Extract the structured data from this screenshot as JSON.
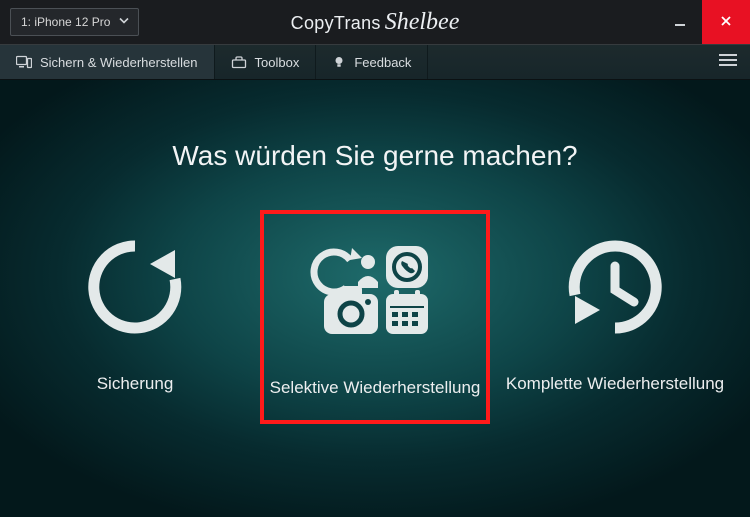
{
  "titlebar": {
    "device_label": "1: iPhone 12 Pro",
    "brand_part1": "CopyTrans",
    "brand_part2": "Shelbee"
  },
  "tabs": {
    "backup_restore": {
      "label": "Sichern & Wiederherstellen"
    },
    "toolbox": {
      "label": "Toolbox"
    },
    "feedback": {
      "label": "Feedback"
    }
  },
  "main": {
    "heading": "Was würden Sie gerne machen?",
    "options": {
      "backup": {
        "label": "Sicherung"
      },
      "selective_restore": {
        "label": "Selektive Wiederherstellung"
      },
      "full_restore": {
        "label": "Komplette Wiederherstellung"
      }
    }
  },
  "icons": {
    "device_chevron": "chevron-down-icon",
    "tab_backup": "devices-icon",
    "tab_toolbox": "toolbox-icon",
    "tab_feedback": "lightbulb-icon",
    "hamburger": "menu-icon",
    "minimize": "minimize-icon",
    "close": "close-icon",
    "opt_backup": "refresh-arrow-icon",
    "opt_selective": "selective-restore-icon",
    "opt_full": "history-restore-icon"
  },
  "colors": {
    "accent_highlight": "#ff1a1a",
    "close_button": "#e81123",
    "icon_fill": "#e3e9e9"
  }
}
